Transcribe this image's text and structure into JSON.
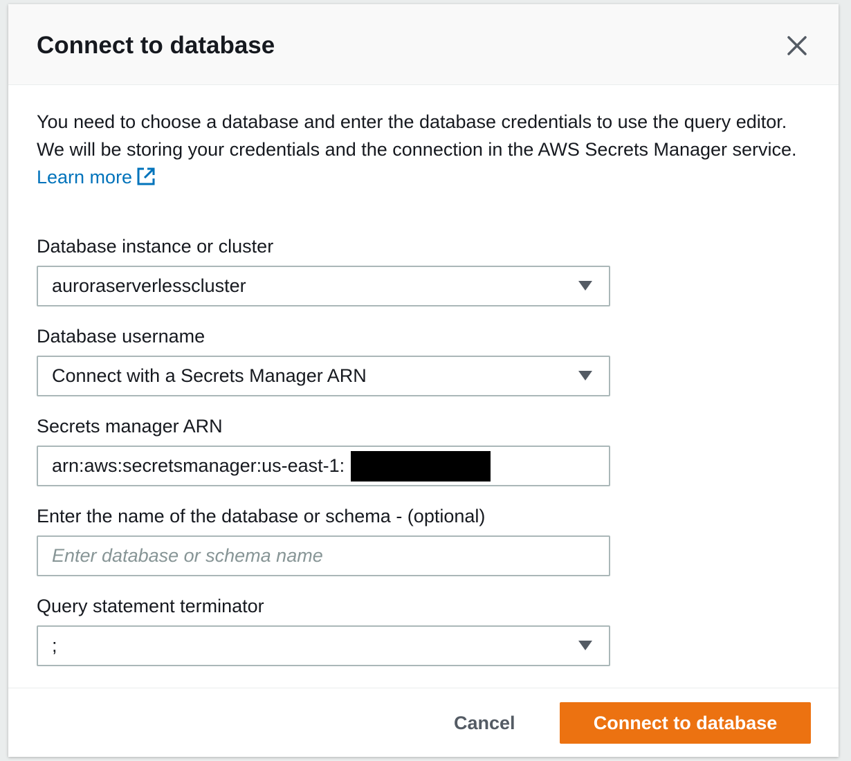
{
  "modal": {
    "title": "Connect to database",
    "close_icon": "close-icon"
  },
  "intro": {
    "text": "You need to choose a database and enter the database credentials to use the query editor. We will be storing your credentials and the connection in the AWS Secrets Manager service.",
    "link_text": "Learn more",
    "link_icon": "external-link-icon"
  },
  "form": {
    "database_instance": {
      "label": "Database instance or cluster",
      "value": "auroraserverlesscluster"
    },
    "database_username": {
      "label": "Database username",
      "value": "Connect with a Secrets Manager ARN"
    },
    "secrets_arn": {
      "label": "Secrets manager ARN",
      "value": "arn:aws:secretsmanager:us-east-1:            :secret:rds-d"
    },
    "database_name": {
      "label": "Enter the name of the database or schema - (optional)",
      "placeholder": "Enter database or schema name",
      "value": ""
    },
    "terminator": {
      "label": "Query statement terminator",
      "value": ";"
    }
  },
  "footer": {
    "cancel_label": "Cancel",
    "connect_label": "Connect to database"
  },
  "colors": {
    "primary_button": "#ec7211",
    "link": "#0073bb",
    "text": "#16191f",
    "border": "#aab7b8"
  }
}
